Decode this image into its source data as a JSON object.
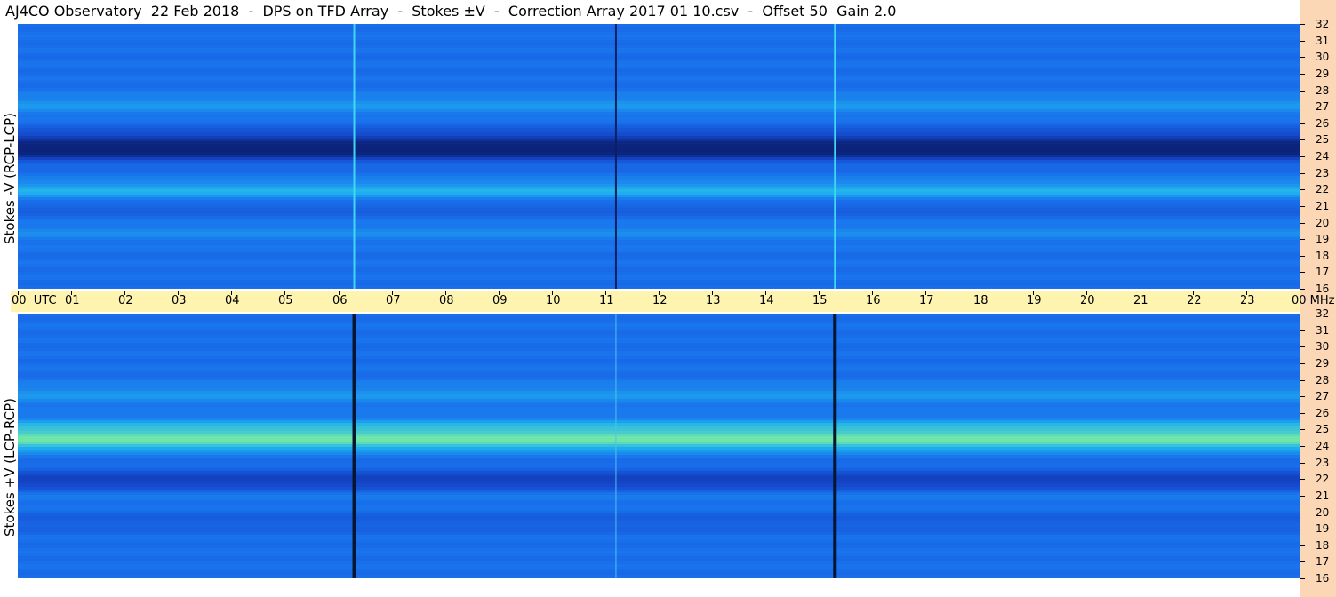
{
  "title": "AJ4CO Observatory  22 Feb 2018  -  DPS on TFD Array  -  Stokes ±V  -  Correction Array 2017 01 10.csv  -  Offset 50  Gain 2.0",
  "colors": {
    "background": "#ffffff",
    "time_strip": "#fff3b0",
    "freq_strip": "#fbd7b5"
  },
  "chart_data": [
    {
      "type": "heatmap",
      "ylabel": "Stokes -V (RCP-LCP)",
      "xlabel": "UTC",
      "x_ticks": [
        "00",
        "01",
        "02",
        "03",
        "04",
        "05",
        "06",
        "07",
        "08",
        "09",
        "10",
        "11",
        "12",
        "13",
        "14",
        "15",
        "16",
        "17",
        "18",
        "19",
        "20",
        "21",
        "22",
        "23",
        "00"
      ],
      "x_range_hours": [
        0,
        24
      ],
      "y_ticks": [
        "32",
        "31",
        "30",
        "29",
        "28",
        "27",
        "26",
        "25",
        "24",
        "23",
        "22",
        "21",
        "20",
        "19",
        "18",
        "17",
        "16"
      ],
      "y_range_mhz": [
        16,
        32
      ],
      "bands": [
        {
          "mhz": 24.4,
          "level": -0.9
        },
        {
          "mhz": 25.2,
          "level": -0.5
        },
        {
          "mhz": 22.0,
          "level": 0.5
        },
        {
          "mhz": 21.0,
          "level": -0.2
        },
        {
          "mhz": 19.5,
          "level": 0.2
        },
        {
          "mhz": 27.2,
          "level": 0.3
        }
      ],
      "vertical_lines_utc": [
        6.3,
        11.2,
        15.3
      ],
      "vertical_line_level": "bright"
    },
    {
      "type": "heatmap",
      "ylabel": "Stokes +V (LCP-RCP)",
      "xlabel": "UTC",
      "x_ticks": [
        "00",
        "01",
        "02",
        "03",
        "04",
        "05",
        "06",
        "07",
        "08",
        "09",
        "10",
        "11",
        "12",
        "13",
        "14",
        "15",
        "16",
        "17",
        "18",
        "19",
        "20",
        "21",
        "22",
        "23",
        "00"
      ],
      "x_range_hours": [
        0,
        24
      ],
      "y_ticks": [
        "32",
        "31",
        "30",
        "29",
        "28",
        "27",
        "26",
        "25",
        "24",
        "23",
        "22",
        "21",
        "20",
        "19",
        "18",
        "17",
        "16"
      ],
      "y_range_mhz": [
        16,
        32
      ],
      "bands": [
        {
          "mhz": 24.4,
          "level": 0.9
        },
        {
          "mhz": 25.2,
          "level": 0.5
        },
        {
          "mhz": 22.0,
          "level": -0.6
        },
        {
          "mhz": 21.0,
          "level": 0.1
        },
        {
          "mhz": 19.5,
          "level": -0.2
        },
        {
          "mhz": 27.2,
          "level": 0.3
        }
      ],
      "vertical_lines_utc": [
        6.3,
        11.2,
        15.3
      ],
      "vertical_line_level": "dark"
    }
  ],
  "units": {
    "time": "UTC",
    "freq": "MHz"
  }
}
